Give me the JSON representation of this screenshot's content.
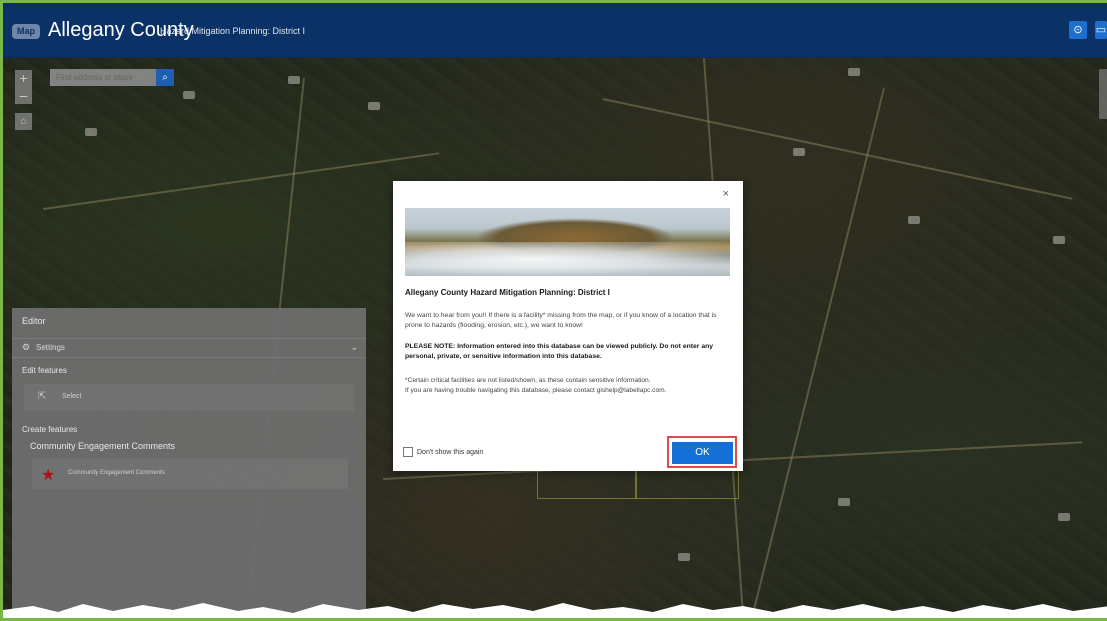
{
  "header": {
    "logo_badge": "Map",
    "title": "Allegany County",
    "subtitle": "Hazard Mitigation Planning: District I"
  },
  "map": {
    "search_placeholder": "Find address or place",
    "zoom_in": "+",
    "zoom_out": "–"
  },
  "editor": {
    "title": "Editor",
    "settings_label": "Settings",
    "edit_features_label": "Edit features",
    "select_label": "Select",
    "create_features_label": "Create features",
    "layer_label": "Community Engagement Comments",
    "template_label": "Community Engagement Comments",
    "template_color": "#b0121a"
  },
  "modal": {
    "close": "×",
    "title": "Allegany County Hazard Mitigation Planning: District I",
    "paragraph1": "We want to hear from you!! If there is a facility* missing from the map, or if you know of a location that is prone to hazards (flooding, erosion, etc.), we want to know!",
    "note_bold": "PLEASE NOTE: Information entered into this database can be viewed publicly.  Do not enter any personal, private, or sensitive information into this database.",
    "paragraph3_line1": "*Certain critical facilities are not listed/shown, as these contain sensitive information.",
    "paragraph3_line2": "If you are having trouble navigating this database, please contact gishelp@labellapc.com.",
    "dont_show_label": "Don't show this again",
    "ok_label": "OK",
    "ok_color": "#1470d6",
    "highlight_color": "#e24a4a"
  }
}
